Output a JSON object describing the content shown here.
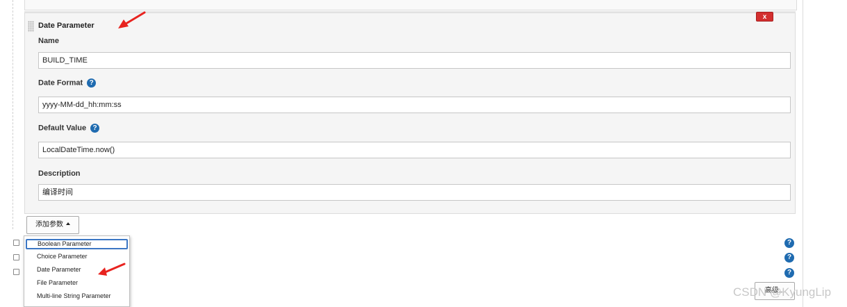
{
  "panel": {
    "title": "Date Parameter",
    "delete_label": "x",
    "fields": {
      "name_label": "Name",
      "name_value": "BUILD_TIME",
      "date_format_label": "Date Format",
      "date_format_value": "yyyy-MM-dd_hh:mm:ss",
      "default_value_label": "Default Value",
      "default_value_value": "LocalDateTime.now()",
      "description_label": "Description",
      "description_value": "编译时间"
    },
    "help_glyph": "?"
  },
  "add_parameter": {
    "label": "添加参数",
    "menu_items": [
      "Boolean Parameter",
      "Choice Parameter",
      "Date Parameter",
      "File Parameter",
      "Multi-line String Parameter"
    ]
  },
  "advanced_button_label": "高级...",
  "watermark": "CSDN @KyungLip",
  "colors": {
    "help_icon": "#1f6bb0",
    "delete_button": "#d32f2f",
    "annotation_arrow": "#e8231f"
  }
}
